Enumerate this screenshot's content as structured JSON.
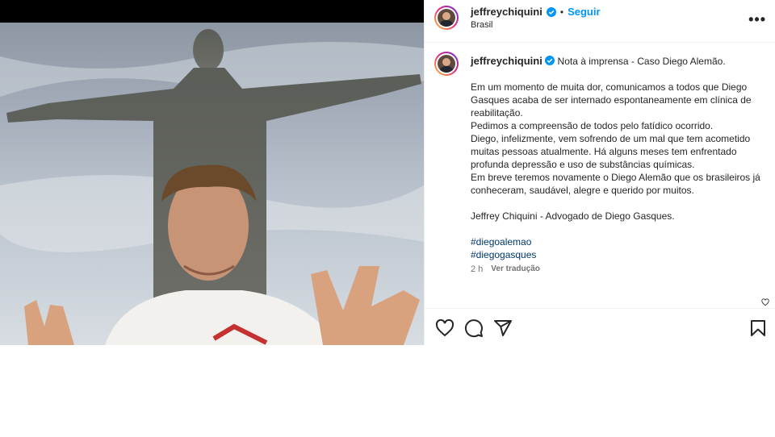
{
  "header": {
    "username": "jeffreychiquini",
    "separator": "•",
    "follow_label": "Seguir",
    "location": "Brasil",
    "more_icon": "more-options-icon"
  },
  "caption": {
    "username": "jeffreychiquini",
    "headline": "Nota à imprensa - Caso Diego Alemão.",
    "paragraph1": "Em um momento de muita dor, comunicamos a todos que Diego Gasques acaba de ser internado espontaneamente em clínica de reabilitação.",
    "paragraph2": "Pedimos a compreensão de todos pelo fatídico ocorrido.",
    "paragraph3": "Diego, infelizmente, vem sofrendo de um mal que tem acometido muitas pessoas atualmente. Há alguns meses tem enfrentado profunda depressão e uso de substâncias químicas.",
    "paragraph4": "Em breve teremos novamente o Diego Alemão que os brasileiros já conheceram, saudável, alegre e querido por muitos.",
    "signature": "Jeffrey Chiquini - Advogado de Diego Gasques.",
    "hashtags": [
      "#diegoalemao",
      "#diegogasques"
    ]
  },
  "meta": {
    "time": "2 h",
    "translate_label": "Ver tradução"
  },
  "actions": {
    "icons": [
      "heart-icon",
      "comment-icon",
      "share-icon",
      "bookmark-icon"
    ]
  },
  "colors": {
    "link": "#0095f6",
    "hashtag": "#00376b",
    "muted": "#737373",
    "verified": "#0095f6"
  }
}
